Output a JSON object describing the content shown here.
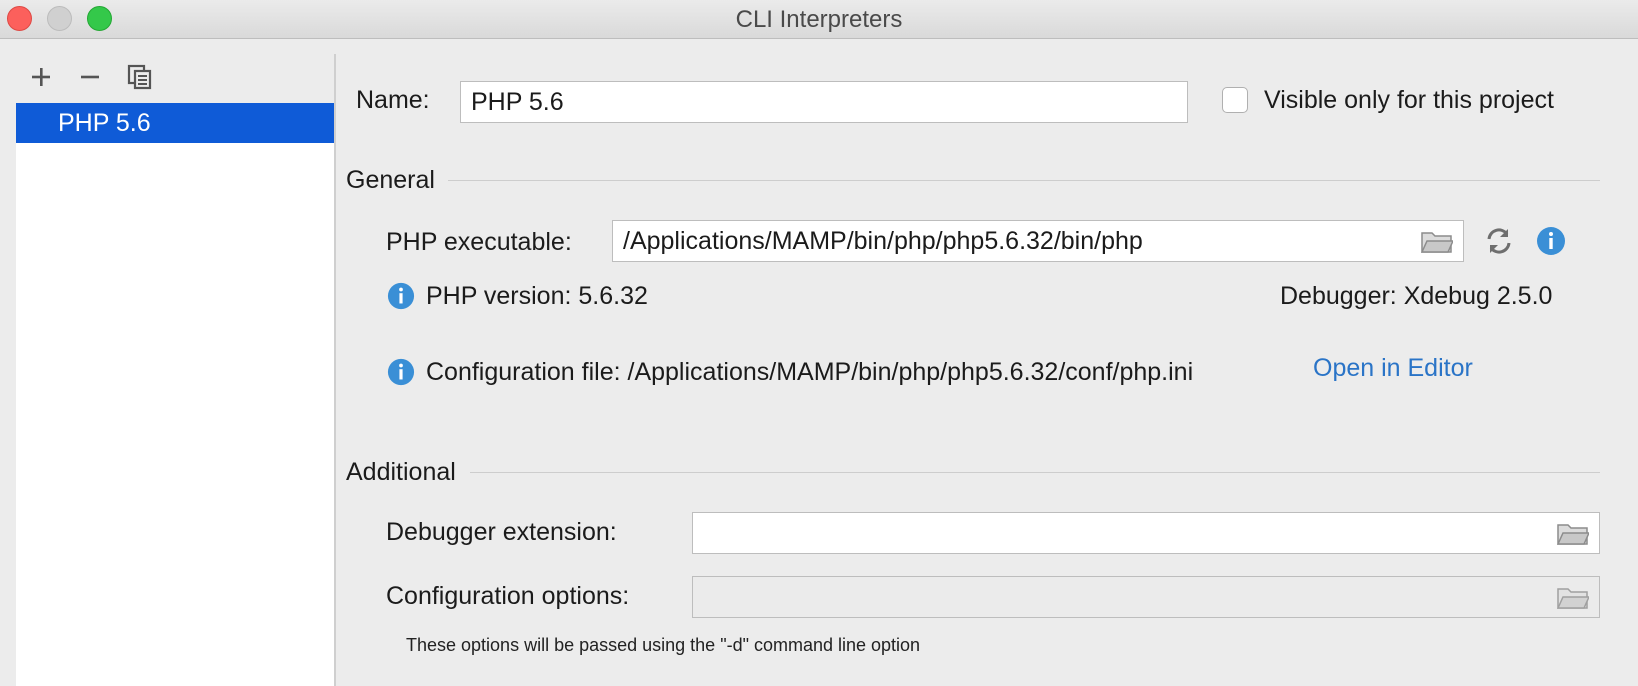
{
  "window": {
    "title": "CLI Interpreters",
    "controls": [
      "close",
      "minimize",
      "maximize"
    ]
  },
  "sidebar": {
    "toolbar": [
      {
        "name": "add",
        "icon": "plus-icon"
      },
      {
        "name": "remove",
        "icon": "minus-icon"
      },
      {
        "name": "copy",
        "icon": "copy-icon"
      }
    ],
    "items": [
      {
        "label": "PHP 5.6",
        "selected": true
      }
    ]
  },
  "form": {
    "name_label": "Name:",
    "name_value": "PHP 5.6",
    "visible_only_label": "Visible only for this project",
    "visible_only_checked": false,
    "general": {
      "section_title": "General",
      "executable_label": "PHP executable:",
      "executable_value": "/Applications/MAMP/bin/php/php5.6.32/bin/php",
      "php_version": "PHP version: 5.6.32",
      "debugger": "Debugger: Xdebug 2.5.0",
      "config_file": "Configuration file: /Applications/MAMP/bin/php/php5.6.32/conf/php.ini",
      "open_in_editor": "Open in Editor"
    },
    "additional": {
      "section_title": "Additional",
      "debugger_ext_label": "Debugger extension:",
      "debugger_ext_value": "",
      "config_options_label": "Configuration options:",
      "config_options_value": "",
      "hint": "These options will be passed using the \"-d\" command line option"
    }
  },
  "colors": {
    "selection": "#0f5bd7",
    "link": "#2a74c7",
    "info": "#3a8fd6",
    "background": "#ececec"
  }
}
